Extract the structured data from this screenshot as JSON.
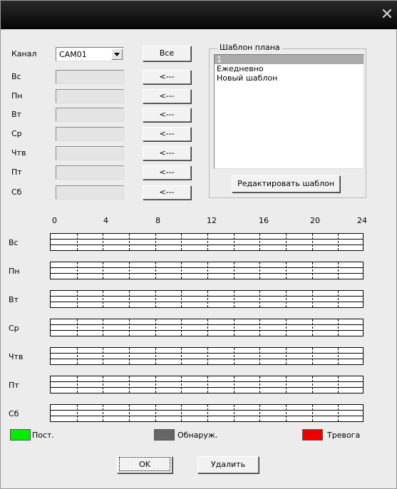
{
  "window": {
    "close_glyph": "✕"
  },
  "channel": {
    "label": "Канал",
    "value": "CAM01",
    "all_button": "Все"
  },
  "days": [
    {
      "label": "Вс",
      "copy_button": "<---"
    },
    {
      "label": "Пн",
      "copy_button": "<---"
    },
    {
      "label": "Вт",
      "copy_button": "<---"
    },
    {
      "label": "Ср",
      "copy_button": "<---"
    },
    {
      "label": "Чтв",
      "copy_button": "<---"
    },
    {
      "label": "Пт",
      "copy_button": "<---"
    },
    {
      "label": "Сб",
      "copy_button": "<---"
    }
  ],
  "template_group": {
    "title": "Шаблон плана",
    "items": [
      "1",
      "Ежедневно",
      "Новый шаблон"
    ],
    "selected_index": 0,
    "edit_button": "Редактировать шаблон"
  },
  "timeline": {
    "hour_labels": [
      "0",
      "4",
      "8",
      "12",
      "16",
      "20",
      "24"
    ],
    "days": [
      "Вс",
      "Пн",
      "Вт",
      "Ср",
      "Чтв",
      "Пт",
      "Сб"
    ]
  },
  "legend": [
    {
      "label": "Пост.",
      "color": "#00ee00"
    },
    {
      "label": "Обнаруж.",
      "color": "#666666"
    },
    {
      "label": "Тревога",
      "color": "#ee0000"
    }
  ],
  "buttons": {
    "ok": "OK",
    "delete": "Удалить"
  }
}
